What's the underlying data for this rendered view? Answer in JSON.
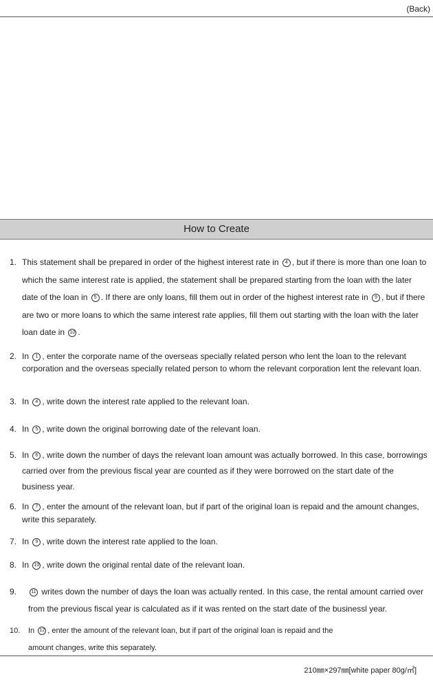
{
  "back_label": "(Back)",
  "section_title": "How to Create",
  "items": [
    {
      "num": "1.",
      "parts": [
        {
          "t": "This statement shall be prepared in order of the highest interest rate in "
        },
        {
          "c": "4"
        },
        {
          "t": ", but if there is more than one loan to which the same interest rate is applied, the statement shall be prepared starting from the loan with the later date of the loan in "
        },
        {
          "c": "5"
        },
        {
          "t": ". If there are only loans, fill them out in order of the highest interest rate in "
        },
        {
          "c": "9"
        },
        {
          "t": ", but if there are two or more loans to which the same interest rate applies, fill them out starting with the loan with the later loan date in "
        },
        {
          "c": "10"
        },
        {
          "t": "."
        }
      ]
    },
    {
      "num": "2.",
      "parts": [
        {
          "t": "In "
        },
        {
          "c": "1"
        },
        {
          "t": ", enter the corporate name of the overseas specially related person who lent the loan to the relevant corporation and the overseas specially related person to whom the relevant corporation lent the relevant loan."
        }
      ]
    },
    {
      "num": "3.",
      "parts": [
        {
          "t": "In "
        },
        {
          "c": "4"
        },
        {
          "t": ", write down the interest rate applied to the relevant loan."
        }
      ]
    },
    {
      "num": "4.",
      "parts": [
        {
          "t": "In "
        },
        {
          "c": "5"
        },
        {
          "t": ", write down the original borrowing date of the relevant loan."
        }
      ]
    },
    {
      "num": "5.",
      "parts": [
        {
          "t": "In "
        },
        {
          "c": "6"
        },
        {
          "t": ", write down the number of days the relevant loan amount was actually borrowed. In this case, borrowings carried over from the previous fiscal year are counted as if they were borrowed on the start date of the business year."
        }
      ]
    },
    {
      "num": "6.",
      "parts": [
        {
          "t": "In "
        },
        {
          "c": "7"
        },
        {
          "t": ", enter the amount of the relevant loan, but if part of the original loan is repaid and the amount changes, write this separately."
        }
      ]
    },
    {
      "num": "7.",
      "parts": [
        {
          "t": "In "
        },
        {
          "c": "9"
        },
        {
          "t": ", write down the interest rate applied to the loan."
        }
      ]
    },
    {
      "num": "8.",
      "parts": [
        {
          "t": "In "
        },
        {
          "c": "10"
        },
        {
          "t": ", write down the original rental date of the relevant loan."
        }
      ]
    },
    {
      "num": "9.",
      "parts": [
        {
          "c": "11"
        },
        {
          "t": " writes down the number of days the loan was actually rented. In this case, the rental amount carried over from the previous fiscal year is calculated as if it was rented on the start date of the businessl year."
        }
      ]
    },
    {
      "num": "10.",
      "parts": [
        {
          "t": "In "
        },
        {
          "c": "12"
        },
        {
          "t": ", enter the amount of the relevant loan, but if part of the original loan is repaid and the amount changes, write this separately."
        }
      ]
    }
  ],
  "footer": "210㎜×297㎜[white paper 80g/㎡]"
}
